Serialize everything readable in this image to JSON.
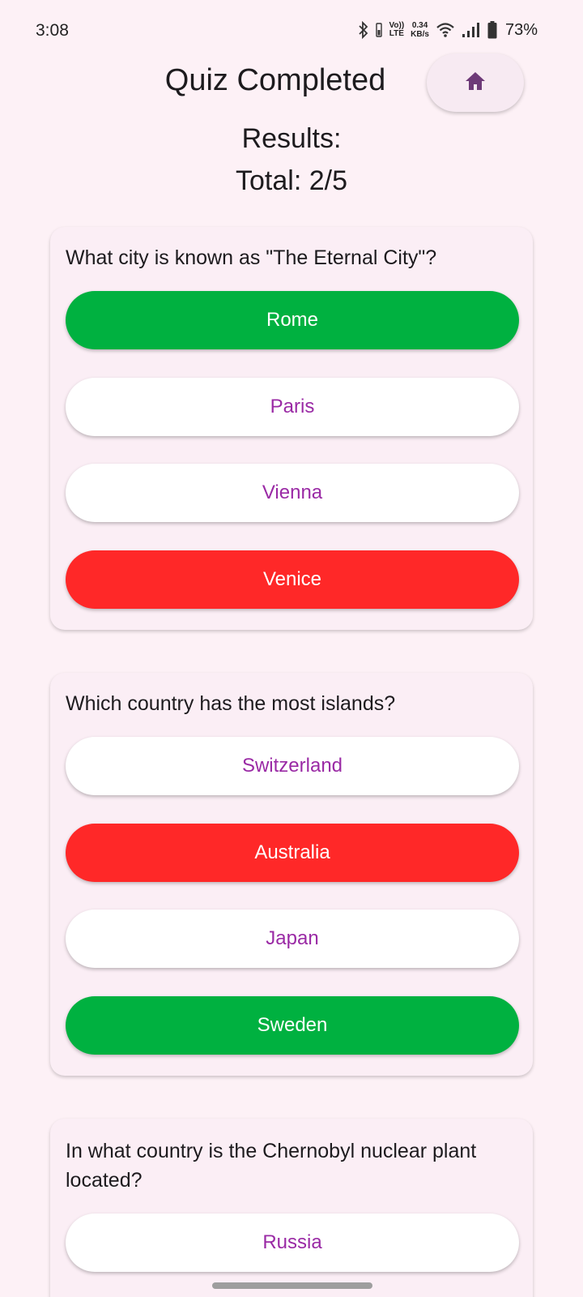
{
  "status_bar": {
    "time": "3:08",
    "lte_top": "Vo))",
    "lte_bottom": "LTE",
    "speed_value": "0.34",
    "speed_unit": "KB/s",
    "battery": "73%"
  },
  "header": {
    "title": "Quiz Completed",
    "home_icon": "home-icon",
    "results": "Results:",
    "total": "Total: 2/5"
  },
  "questions": [
    {
      "text": "What city is known as \"The Eternal City\"?",
      "answers": [
        {
          "label": "Rome",
          "state": "correct"
        },
        {
          "label": "Paris",
          "state": "neutral"
        },
        {
          "label": "Vienna",
          "state": "neutral"
        },
        {
          "label": "Venice",
          "state": "wrong"
        }
      ]
    },
    {
      "text": "Which country has the most islands?",
      "answers": [
        {
          "label": "Switzerland",
          "state": "neutral"
        },
        {
          "label": "Australia",
          "state": "wrong"
        },
        {
          "label": "Japan",
          "state": "neutral"
        },
        {
          "label": "Sweden",
          "state": "correct"
        }
      ]
    },
    {
      "text": "In what country is the Chernobyl nuclear plant located?",
      "answers": [
        {
          "label": "Russia",
          "state": "neutral"
        }
      ]
    }
  ],
  "colors": {
    "background": "#fdf1f6",
    "correct": "#00b140",
    "wrong": "#ff2828",
    "neutral_text": "#9a2aa5",
    "home_icon": "#6e3a78"
  }
}
